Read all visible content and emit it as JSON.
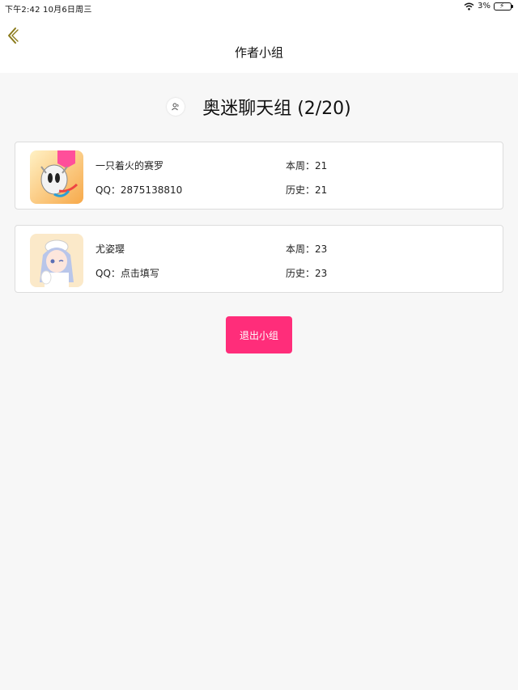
{
  "status_bar": {
    "time_date": "下午2:42   10月6日周三",
    "battery": "3%"
  },
  "nav": {
    "title": "作者小组"
  },
  "group": {
    "name": "奥迷聊天组 (2/20)"
  },
  "members": [
    {
      "name": "一只着火的赛罗",
      "qq": "QQ：2875138810",
      "week": "本周：21",
      "history": "历史：21"
    },
    {
      "name": "尤姿璎",
      "qq": "QQ：点击填写",
      "week": "本周：23",
      "history": "历史：23"
    }
  ],
  "actions": {
    "quit_label": "退出小组"
  },
  "colors": {
    "accent": "#ff2d7a",
    "back_arrow": "#8a7a1a"
  }
}
